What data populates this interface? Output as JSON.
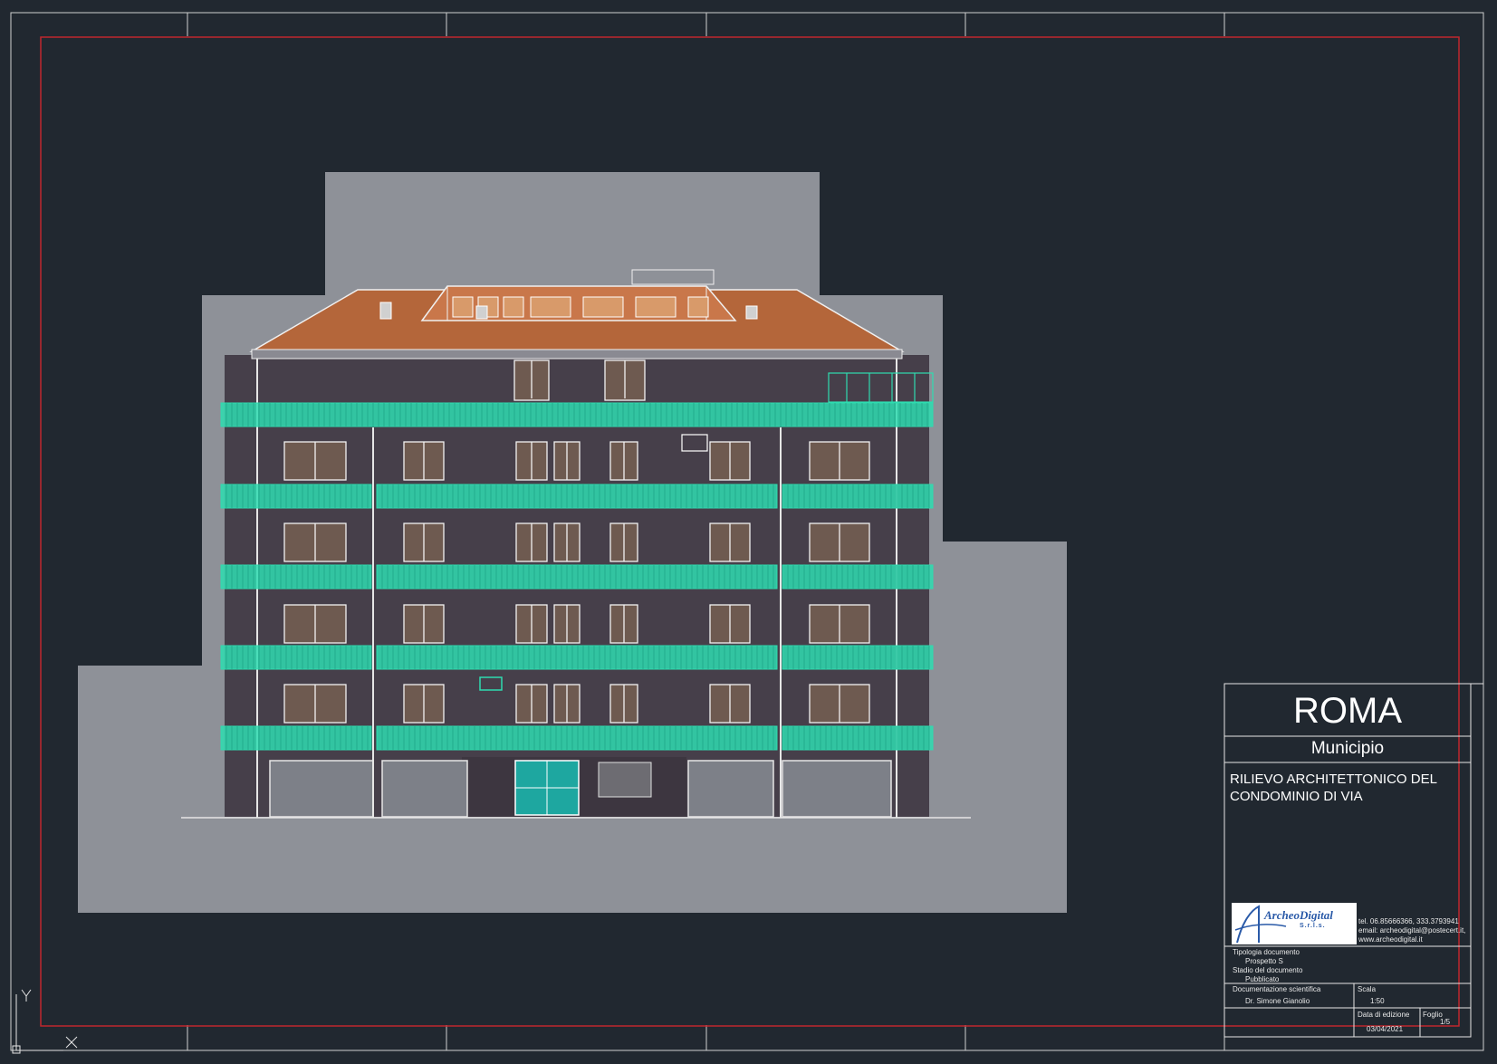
{
  "title_block": {
    "city": "ROMA",
    "municipio": "Municipio",
    "project_line1": "RILIEVO ARCHITETTONICO DEL",
    "project_line2": "CONDOMINIO DI VIA",
    "logo_name": "ArcheoDigital",
    "logo_suffix": "S.r.l.s.",
    "contact_tel": "tel. 06.85666366, 333.3793941",
    "contact_email": "email: archeodigital@postecert.it,",
    "contact_web": "www.archeodigital.it",
    "tipologia_label": "Tipologia documento",
    "tipologia_value": "Prospetto S",
    "stadio_label": "Stadio del documento",
    "stadio_value": "Pubblicato",
    "documentazione_label": "Documentazione scientifica",
    "documentazione_value": "Dr. Simone Gianolio",
    "scala_label": "Scala",
    "scala_value": "1:50",
    "data_label": "Data di edizione",
    "data_value": "03/04/2021",
    "foglio_label": "Foglio",
    "foglio_value": "1/5"
  },
  "ucs_icon": {
    "y_label": "Y",
    "x_label": "X"
  },
  "colors": {
    "background": "#212830",
    "frame_line": "#d0d0d0",
    "border_red": "#c0272d",
    "scan_bg": "#8e9198",
    "facade": "#463f4a",
    "roof": "#b4663a",
    "balcony": "#2fdcb0"
  }
}
